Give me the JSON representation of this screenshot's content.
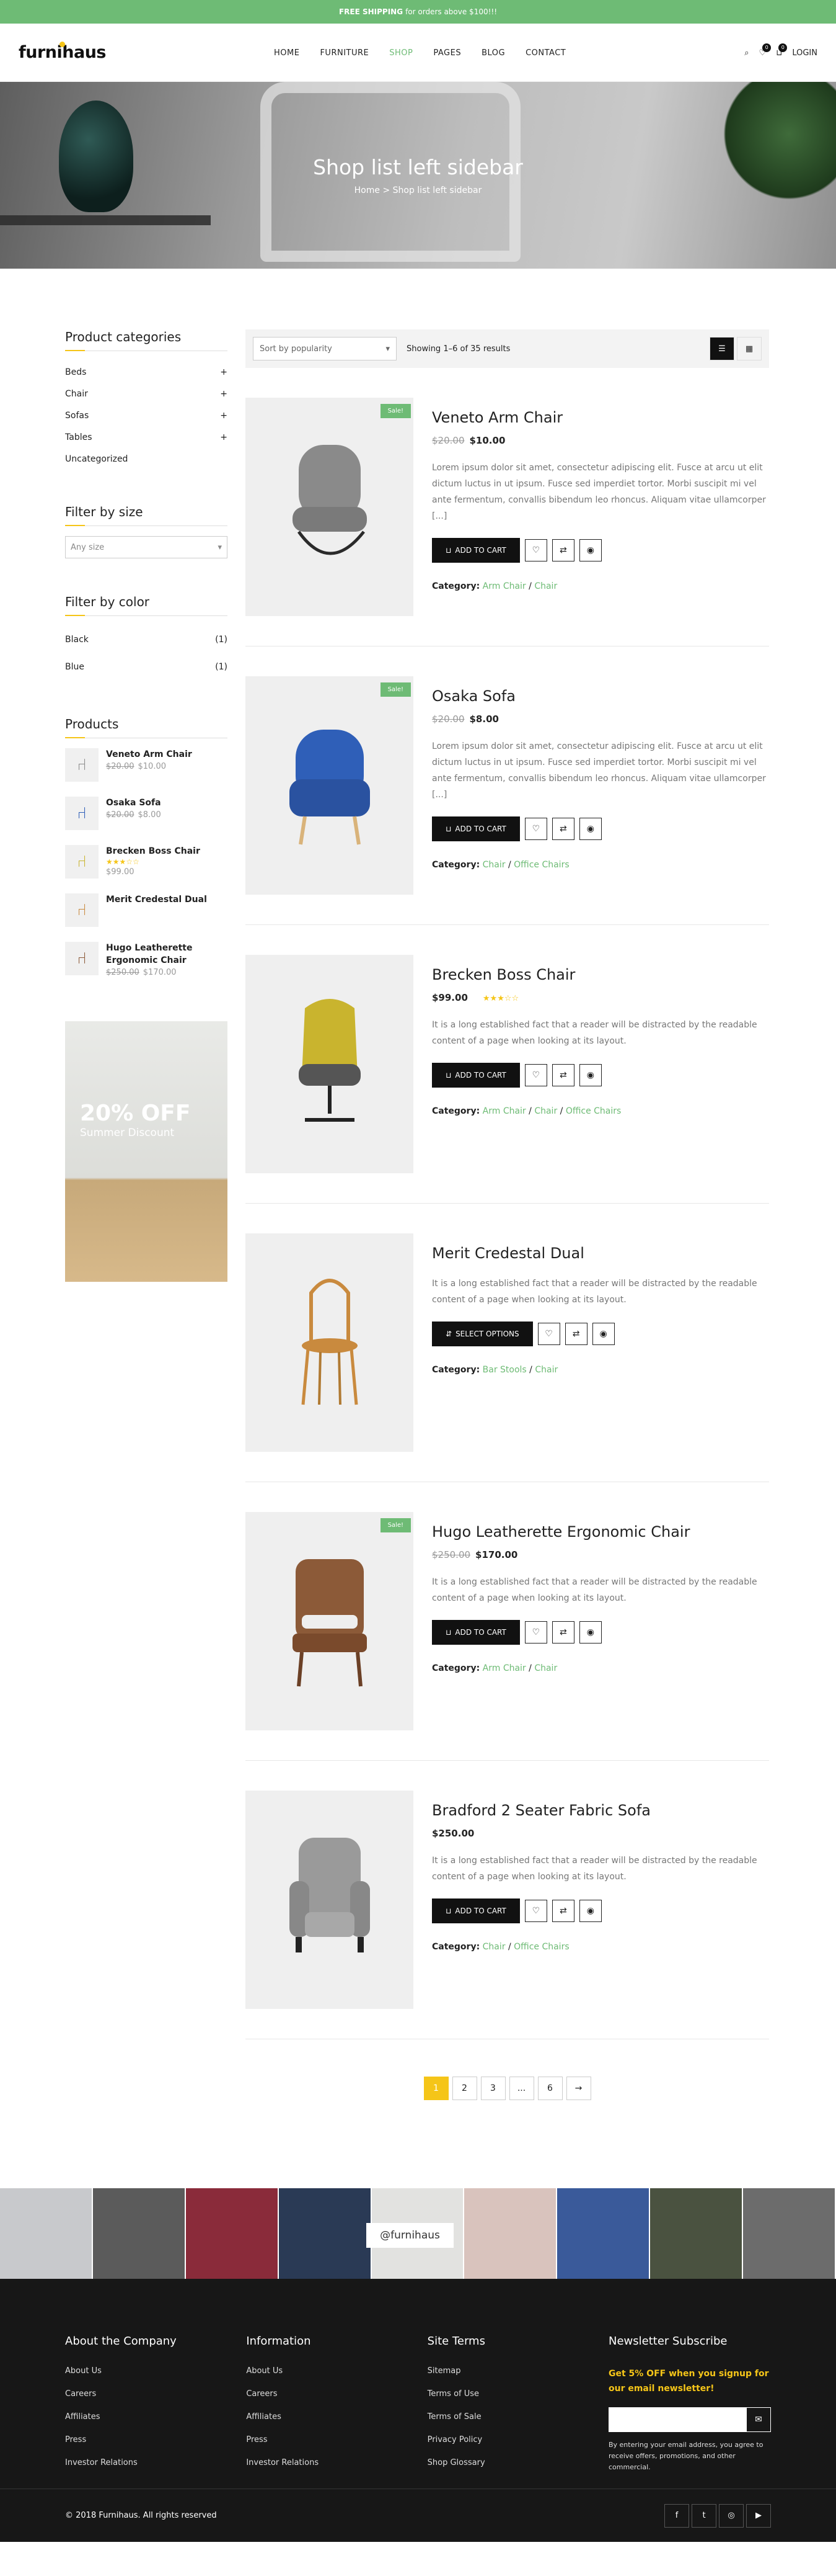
{
  "topbar": {
    "bold": "FREE SHIPPING",
    "rest": "for orders above $100!!!"
  },
  "header": {
    "logo": "furnihaus",
    "nav": [
      "HOME",
      "FURNITURE",
      "SHOP",
      "PAGES",
      "BLOG",
      "CONTACT"
    ],
    "nav_active_index": 2,
    "wishlist_count": "0",
    "cart_count": "0",
    "login": "LOGIN"
  },
  "hero": {
    "title": "Shop list left sidebar",
    "crumb_home": "Home",
    "crumb_sep": ">",
    "crumb_current": "Shop list left sidebar"
  },
  "sidebar": {
    "categories_title": "Product categories",
    "categories": [
      {
        "label": "Beds",
        "expand": "+"
      },
      {
        "label": "Chair",
        "expand": "+"
      },
      {
        "label": "Sofas",
        "expand": "+"
      },
      {
        "label": "Tables",
        "expand": "+"
      },
      {
        "label": "Uncategorized",
        "expand": ""
      }
    ],
    "size_title": "Filter by size",
    "size_placeholder": "Any size",
    "color_title": "Filter by color",
    "colors": [
      {
        "label": "Black",
        "count": "(1)"
      },
      {
        "label": "Blue",
        "count": "(1)"
      }
    ],
    "products_title": "Products",
    "products": [
      {
        "name": "Veneto Arm Chair",
        "old": "$20.00",
        "price": "$10.00",
        "stars": ""
      },
      {
        "name": "Osaka Sofa",
        "old": "$20.00",
        "price": "$8.00",
        "stars": ""
      },
      {
        "name": "Brecken Boss Chair",
        "old": "",
        "price": "$99.00",
        "stars": "★★★☆☆"
      },
      {
        "name": "Merit Credestal Dual",
        "old": "",
        "price": "",
        "stars": ""
      },
      {
        "name": "Hugo Leatherette Ergonomic Chair",
        "old": "$250.00",
        "price": "$170.00",
        "stars": ""
      }
    ],
    "banner_big": "20% OFF",
    "banner_small": "Summer Discount"
  },
  "toolbar": {
    "sort": "Sort by popularity",
    "result": "Showing 1–6 of 35 results"
  },
  "products": [
    {
      "name": "Veneto Arm Chair",
      "sale": "Sale!",
      "old": "$20.00",
      "price": "$10.00",
      "stars": "",
      "desc": "Lorem ipsum dolor sit amet, consectetur adipiscing elit. Fusce at arcu ut elit dictum luctus in ut ipsum. Fusce sed imperdiet tortor. Morbi suscipit mi vel ante fermentum, convallis bibendum leo rhoncus. Aliquam vitae ullamcorper [...]",
      "button": "ADD TO CART",
      "cat_label": "Category:",
      "cats": [
        "Arm Chair",
        "Chair"
      ],
      "color": "#8a8a8a"
    },
    {
      "name": "Osaka Sofa",
      "sale": "Sale!",
      "old": "$20.00",
      "price": "$8.00",
      "stars": "",
      "desc": "Lorem ipsum dolor sit amet, consectetur adipiscing elit. Fusce at arcu ut elit dictum luctus in ut ipsum. Fusce sed imperdiet tortor. Morbi suscipit mi vel ante fermentum, convallis bibendum leo rhoncus. Aliquam vitae ullamcorper [...]",
      "button": "ADD TO CART",
      "cat_label": "Category:",
      "cats": [
        "Chair",
        "Office Chairs"
      ],
      "color": "#2f5fb8"
    },
    {
      "name": "Brecken Boss Chair",
      "sale": "",
      "old": "",
      "price": "$99.00",
      "stars": "★★★☆☆",
      "desc": "It is a long established fact that a reader will be distracted by the readable content of a page when looking at its layout.",
      "button": "ADD TO CART",
      "cat_label": "Category:",
      "cats": [
        "Arm Chair",
        "Chair",
        "Office Chairs"
      ],
      "color": "#c9b42e"
    },
    {
      "name": "Merit Credestal Dual",
      "sale": "",
      "old": "",
      "price": "",
      "stars": "",
      "desc": "It is a long established fact that a reader will be distracted by the readable content of a page when looking at its layout.",
      "button": "SELECT OPTIONS",
      "cat_label": "Category:",
      "cats": [
        "Bar Stools",
        "Chair"
      ],
      "color": "#c98a3e"
    },
    {
      "name": "Hugo Leatherette Ergonomic Chair",
      "sale": "Sale!",
      "old": "$250.00",
      "price": "$170.00",
      "stars": "",
      "desc": "It is a long established fact that a reader will be distracted by the readable content of a page when looking at its layout.",
      "button": "ADD TO CART",
      "cat_label": "Category:",
      "cats": [
        "Arm Chair",
        "Chair"
      ],
      "color": "#8c5a38"
    },
    {
      "name": "Bradford 2 Seater Fabric Sofa",
      "sale": "",
      "old": "",
      "price": "$250.00",
      "stars": "",
      "desc": "It is a long established fact that a reader will be distracted by the readable content of a page when looking at its layout.",
      "button": "ADD TO CART",
      "cat_label": "Category:",
      "cats": [
        "Chair",
        "Office Chairs"
      ],
      "color": "#999999"
    }
  ],
  "pagination": [
    "1",
    "2",
    "3",
    "...",
    "6",
    "→"
  ],
  "instagram": {
    "handle": "@furnihaus"
  },
  "footer": {
    "cols": [
      {
        "title": "About the Company",
        "links": [
          "About Us",
          "Careers",
          "Affiliates",
          "Press",
          "Investor Relations"
        ]
      },
      {
        "title": "Information",
        "links": [
          "About Us",
          "Careers",
          "Affiliates",
          "Press",
          "Investor Relations"
        ]
      },
      {
        "title": "Site Terms",
        "links": [
          "Sitemap",
          "Terms of Use",
          "Terms of Sale",
          "Privacy Policy",
          "Shop Glossary"
        ]
      }
    ],
    "news_title": "Newsletter Subscribe",
    "news_highlight": "Get 5% OFF when you signup for our email newsletter!",
    "news_note": "By entering your email address, you agree to receive offers, promotions, and other commercial.",
    "copyright": "© 2018 Furnihaus. All rights reserved",
    "social": [
      "f",
      "t",
      "◎",
      "▶"
    ]
  }
}
